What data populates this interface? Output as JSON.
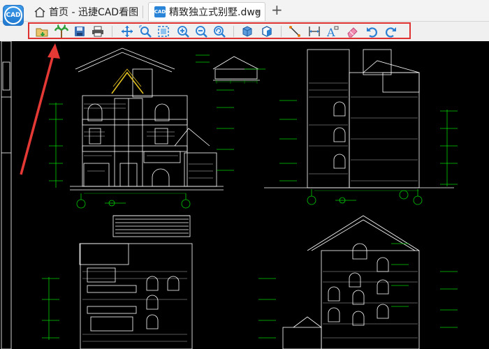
{
  "tabs": {
    "home_label": "首页 - 迅捷CAD看图",
    "file_label": "精致独立式别墅.dwg",
    "close_glyph": "×",
    "new_tab_glyph": "+"
  },
  "app_logo": "CAD",
  "doc_icon_text": "CAD",
  "toolbar_icons": [
    "open-file-icon",
    "palm-tree-icon",
    "save-icon",
    "print-icon",
    "pan-icon",
    "zoom-window-icon",
    "zoom-extents-icon",
    "zoom-in-icon",
    "zoom-out-icon",
    "zoom-previous-icon",
    "3d-view-icon",
    "3d-orbit-icon",
    "measure-distance-icon",
    "measure-dimension-icon",
    "text-icon",
    "eraser-icon",
    "undo-icon",
    "redo-icon"
  ],
  "colors": {
    "highlight_frame": "#e03131",
    "canvas": "#000000",
    "lines": "#ffffff",
    "annotations": "#00d000",
    "accent": "#2a84d7"
  }
}
